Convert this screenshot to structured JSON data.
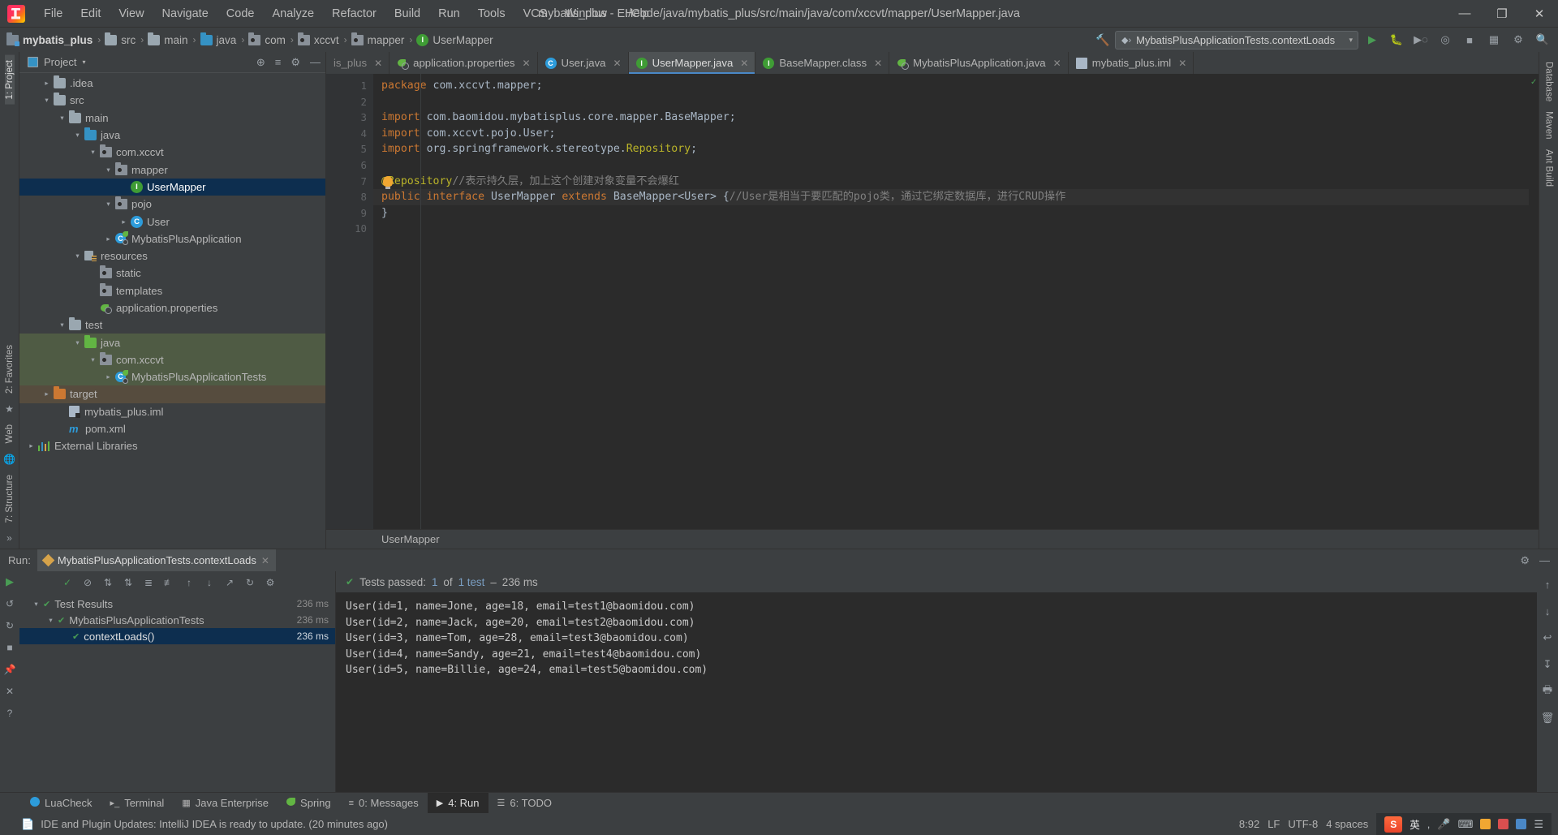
{
  "window": {
    "title": "mybatis_plus - E:/Code/java/mybatis_plus/src/main/java/com/xccvt/mapper/UserMapper.java",
    "minimize": "—",
    "maximize": "❐",
    "close": "✕"
  },
  "menu": {
    "items": [
      "File",
      "Edit",
      "View",
      "Navigate",
      "Code",
      "Analyze",
      "Refactor",
      "Build",
      "Run",
      "Tools",
      "VCS",
      "Window",
      "Help"
    ]
  },
  "breadcrumb": {
    "items": [
      {
        "label": "mybatis_plus",
        "icon": "module-icon",
        "bold": true
      },
      {
        "label": "src",
        "icon": "folder-icon"
      },
      {
        "label": "main",
        "icon": "folder-icon"
      },
      {
        "label": "java",
        "icon": "source-folder-icon"
      },
      {
        "label": "com",
        "icon": "package-icon"
      },
      {
        "label": "xccvt",
        "icon": "package-icon"
      },
      {
        "label": "mapper",
        "icon": "package-icon"
      },
      {
        "label": "UserMapper",
        "icon": "interface-icon"
      }
    ],
    "separator": "›"
  },
  "toolbar": {
    "hammer": "build-icon",
    "run_config": "MybatisPlusApplicationTests.contextLoads",
    "run_config_caret": "▾",
    "run": "▶",
    "debug": "debug-icon",
    "run_with_coverage": "coverage-icon",
    "profiler": "profiler-icon",
    "stop": "■",
    "search_everywhere": "search-icon"
  },
  "left_strip": {
    "project_label": "1: Project",
    "favorites_label": "2: Favorites",
    "structure_label": "7: Structure",
    "web_label": "Web",
    "more": "»"
  },
  "right_strip": {
    "database_label": "Database",
    "maven_label": "Maven",
    "ant_label": "Ant Build"
  },
  "project_panel": {
    "title": "Project",
    "caret": "▾",
    "locate_icon": "target-icon",
    "collapse_icon": "collapse-all-icon",
    "settings_icon": "gear-icon",
    "hide_icon": "—",
    "tree": [
      {
        "label": ".idea",
        "indent": 1,
        "arrow": "▸",
        "icon": "folder"
      },
      {
        "label": "src",
        "indent": 1,
        "arrow": "▾",
        "icon": "folder"
      },
      {
        "label": "main",
        "indent": 2,
        "arrow": "▾",
        "icon": "folder"
      },
      {
        "label": "java",
        "indent": 3,
        "arrow": "▾",
        "icon": "folder-blue"
      },
      {
        "label": "com.xccvt",
        "indent": 4,
        "arrow": "▾",
        "icon": "package"
      },
      {
        "label": "mapper",
        "indent": 5,
        "arrow": "▾",
        "icon": "package"
      },
      {
        "label": "UserMapper",
        "indent": 6,
        "arrow": "",
        "icon": "interface",
        "selected": true
      },
      {
        "label": "pojo",
        "indent": 5,
        "arrow": "▾",
        "icon": "package"
      },
      {
        "label": "User",
        "indent": 6,
        "arrow": "▸",
        "icon": "class"
      },
      {
        "label": "MybatisPlusApplication",
        "indent": 5,
        "arrow": "▸",
        "icon": "springboot"
      },
      {
        "label": "resources",
        "indent": 3,
        "arrow": "▾",
        "icon": "resources"
      },
      {
        "label": "static",
        "indent": 4,
        "arrow": "",
        "icon": "package"
      },
      {
        "label": "templates",
        "indent": 4,
        "arrow": "",
        "icon": "package"
      },
      {
        "label": "application.properties",
        "indent": 4,
        "arrow": "",
        "icon": "spring-props"
      },
      {
        "label": "test",
        "indent": 2,
        "arrow": "▾",
        "icon": "folder"
      },
      {
        "label": "java",
        "indent": 3,
        "arrow": "▾",
        "icon": "folder-green",
        "testsrc": true
      },
      {
        "label": "com.xccvt",
        "indent": 4,
        "arrow": "▾",
        "icon": "package",
        "testsrc": true
      },
      {
        "label": "MybatisPlusApplicationTests",
        "indent": 5,
        "arrow": "▸",
        "icon": "springboot",
        "testsrc": true
      },
      {
        "label": "target",
        "indent": 1,
        "arrow": "▸",
        "icon": "folder-orange",
        "targetrc": true
      },
      {
        "label": "mybatis_plus.iml",
        "indent": 2,
        "arrow": "",
        "icon": "iml"
      },
      {
        "label": "pom.xml",
        "indent": 2,
        "arrow": "",
        "icon": "maven"
      },
      {
        "label": "External Libraries",
        "indent": 0,
        "arrow": "▸",
        "icon": "libs"
      }
    ]
  },
  "editor_tabs": [
    {
      "label": "is_plus",
      "icon": "iml-icon",
      "close": "✕",
      "active": false,
      "truncated": true
    },
    {
      "label": "application.properties",
      "icon": "spring-icon",
      "close": "✕",
      "active": false
    },
    {
      "label": "User.java",
      "icon": "class-icon",
      "close": "✕",
      "active": false
    },
    {
      "label": "UserMapper.java",
      "icon": "interface-icon",
      "close": "✕",
      "active": true
    },
    {
      "label": "BaseMapper.class",
      "icon": "class-file-icon",
      "close": "✕",
      "active": false
    },
    {
      "label": "MybatisPlusApplication.java",
      "icon": "spring-icon",
      "close": "✕",
      "active": false
    },
    {
      "label": "mybatis_plus.iml",
      "icon": "iml-icon",
      "close": "✕",
      "active": false
    }
  ],
  "editor": {
    "line_numbers": [
      "1",
      "2",
      "3",
      "4",
      "5",
      "6",
      "7",
      "8",
      "9",
      "10"
    ],
    "lines": [
      {
        "n": 1,
        "tokens": [
          {
            "t": "package ",
            "c": "kw"
          },
          {
            "t": "com.xccvt.mapper",
            "c": "pl"
          },
          {
            "t": ";",
            "c": "sep2"
          }
        ]
      },
      {
        "n": 2,
        "tokens": []
      },
      {
        "n": 3,
        "tokens": [
          {
            "t": "import ",
            "c": "kw"
          },
          {
            "t": "com.baomidou.mybatisplus.core.mapper.BaseMapper",
            "c": "pl"
          },
          {
            "t": ";",
            "c": "sep2"
          }
        ]
      },
      {
        "n": 4,
        "tokens": [
          {
            "t": "import ",
            "c": "kw"
          },
          {
            "t": "com.xccvt.pojo.User",
            "c": "pl"
          },
          {
            "t": ";",
            "c": "sep2"
          }
        ]
      },
      {
        "n": 5,
        "tokens": [
          {
            "t": "import ",
            "c": "kw"
          },
          {
            "t": "org.springframework.stereotype.",
            "c": "pl"
          },
          {
            "t": "Repository",
            "c": "ann"
          },
          {
            "t": ";",
            "c": "sep2"
          }
        ]
      },
      {
        "n": 6,
        "tokens": []
      },
      {
        "n": 7,
        "tokens": [
          {
            "t": "@Repository",
            "c": "ann"
          },
          {
            "t": "//表示持久层，加上这个创建对象变量不会爆红",
            "c": "cmt"
          }
        ]
      },
      {
        "n": 8,
        "highlight": true,
        "tokens": [
          {
            "t": "public interface ",
            "c": "kw"
          },
          {
            "t": "UserMapper",
            "c": "cls"
          },
          {
            "t": " extends ",
            "c": "kw"
          },
          {
            "t": "BaseMapper<User> ",
            "c": "cls"
          },
          {
            "t": "{",
            "c": "sep2"
          },
          {
            "t": "//User是相当于要匹配的pojo类，通过它绑定数据库，进行CRUD操作",
            "c": "cmt"
          }
        ]
      },
      {
        "n": 9,
        "tokens": [
          {
            "t": "}",
            "c": "sep2"
          }
        ]
      },
      {
        "n": 10,
        "tokens": []
      }
    ],
    "fold_markers": [
      "3",
      "5"
    ],
    "gutter_run_line": 8,
    "intention_bulb_line": 7,
    "status_crumb": "UserMapper",
    "inspection_ok": "✓"
  },
  "run_window": {
    "label": "Run:",
    "tab_title": "MybatisPlusApplicationTests.contextLoads",
    "tab_close": "✕",
    "settings_icon": "gear-icon",
    "hide_icon": "—",
    "toolbar_icons": [
      "rerun-icon",
      "toggle-auto-test-icon",
      "sort-by-duration-icon",
      "sort-alpha-icon",
      "expand-all-icon",
      "collapse-all-icon",
      "prev-failed-icon",
      "next-failed-icon",
      "export-icon",
      "history-icon",
      "settings-icon"
    ],
    "tree": [
      {
        "label": "Test Results",
        "indent": 0,
        "arrow": "▾",
        "ms": "236 ms"
      },
      {
        "label": "MybatisPlusApplicationTests",
        "indent": 1,
        "arrow": "▾",
        "ms": "236 ms"
      },
      {
        "label": "contextLoads()",
        "indent": 2,
        "arrow": "",
        "ms": "236 ms",
        "selected": true
      }
    ],
    "status": {
      "prefix": "Tests passed:",
      "count": "1",
      "of": "of",
      "total": "1 test",
      "dash": "–",
      "time": "236 ms"
    },
    "console_lines": [
      "User(id=1, name=Jone, age=18, email=test1@baomidou.com)",
      "User(id=2, name=Jack, age=20, email=test2@baomidou.com)",
      "User(id=3, name=Tom, age=28, email=test3@baomidou.com)",
      "User(id=4, name=Sandy, age=21, email=test4@baomidou.com)",
      "User(id=5, name=Billie, age=24, email=test5@baomidou.com)"
    ],
    "right_icons": [
      "scroll-up-icon",
      "scroll-down-icon",
      "soft-wrap-icon",
      "scroll-to-end-icon",
      "print-icon",
      "clear-all-icon"
    ]
  },
  "bottom_tools": [
    {
      "label": "LuaCheck",
      "icon": "lua-icon",
      "active": false
    },
    {
      "label": "Terminal",
      "icon": "terminal-icon",
      "active": false
    },
    {
      "label": "Java Enterprise",
      "icon": "java-ee-icon",
      "active": false
    },
    {
      "label": "Spring",
      "icon": "spring-icon",
      "active": false
    },
    {
      "label": "0: Messages",
      "icon": "messages-icon",
      "active": false,
      "mnemonic": "0"
    },
    {
      "label": "4: Run",
      "icon": "▶",
      "active": true,
      "mnemonic": "4"
    },
    {
      "label": "6: TODO",
      "icon": "todo-icon",
      "active": false,
      "mnemonic": "6"
    }
  ],
  "status_bar": {
    "icon": "notification-icon",
    "message": "IDE and Plugin Updates: IntelliJ IDEA is ready to update. (20 minutes ago)",
    "caret_position": "8:92",
    "line_sep": "LF",
    "encoding": "UTF-8",
    "indent": "4 spaces",
    "tray": {
      "sogou": "S",
      "lang": "英",
      "items": [
        "punctuation-icon",
        "mic-icon",
        "keyboard-icon",
        "toolbox-icon",
        "emoji-icon",
        "skin-icon",
        "menu-icon"
      ]
    }
  },
  "colors": {
    "accent_blue": "#4a88c7",
    "selection_blue": "#0d2e4f",
    "green": "#499c54",
    "orange": "#cc7832",
    "editor_bg": "#2b2b2b",
    "panel_bg": "#3c3f41"
  }
}
